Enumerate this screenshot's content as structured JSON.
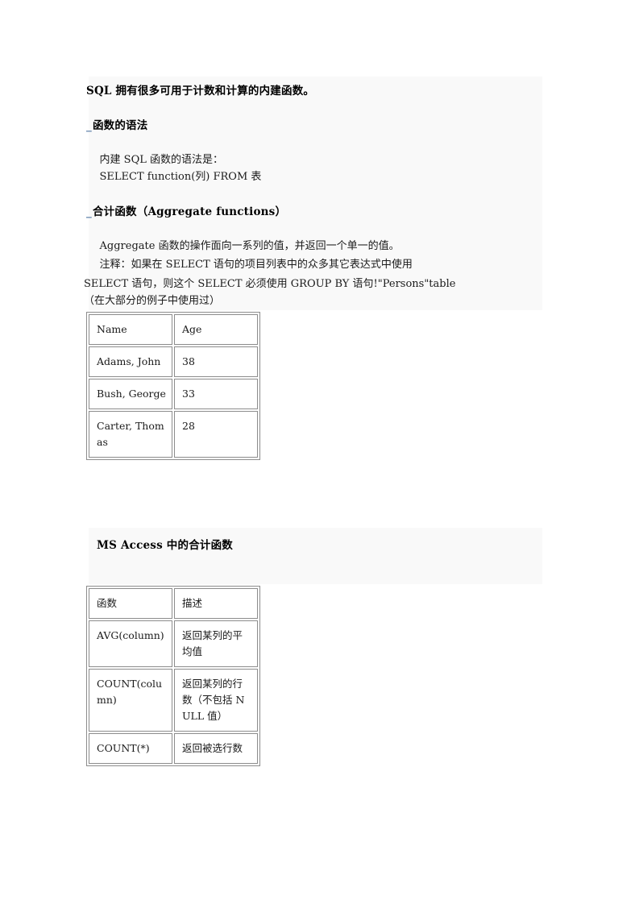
{
  "document": {
    "intro_heading": "SQL 拥有很多可用于计数和计算的内建函数。",
    "underscore_mark": "_",
    "sections": [
      {
        "id": "syntax",
        "heading": "函数的语法",
        "lines": [
          "    内建 SQL 函数的语法是：",
          "    SELECT function(列) FROM 表"
        ]
      },
      {
        "id": "aggregate",
        "heading": "合计函数（Aggregate functions）",
        "lines": [
          "    Aggregate 函数的操作面向一系列的值，并返回一个单一的值。",
          "    注释：如果在 SELECT 语句的项目列表中的众多其它表达式中使用",
          "SELECT 语句，则这个 SELECT 必须使用 GROUP BY 语句!\"Persons\"table",
          "（在大部分的例子中使用过）"
        ]
      }
    ],
    "ms_access_heading": "MS Access 中的合计函数"
  },
  "tables": {
    "persons": {
      "name": "Persons",
      "headers": [
        "Name",
        "Age"
      ],
      "rows": [
        [
          "Adams, John",
          "38"
        ],
        [
          "Bush, George",
          "33"
        ],
        [
          "Carter, Thomas",
          "28"
        ]
      ]
    },
    "functions": {
      "headers": [
        "函数",
        "描述"
      ],
      "rows": [
        [
          "AVG(column)",
          "返回某列的平均值"
        ],
        [
          "COUNT(column)",
          "返回某列的行数（不包括 NULL 值）"
        ],
        [
          "COUNT(*)",
          "返回被选行数"
        ]
      ]
    }
  },
  "colors": {
    "shade_background": "#f9f9f9",
    "underscore_accent": "#6a8ab0",
    "table_border": "#8c8c8c",
    "text": "#1a1a1a"
  }
}
